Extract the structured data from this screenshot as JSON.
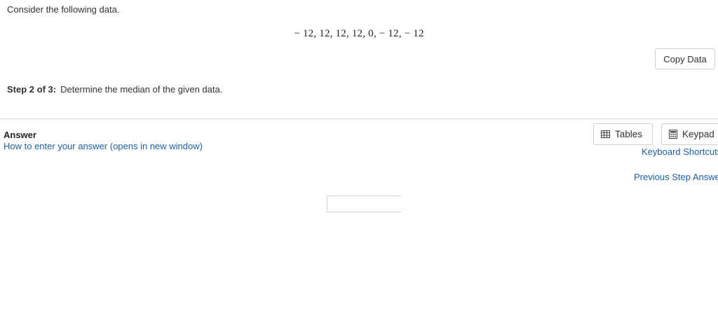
{
  "question": {
    "intro": "Consider the following data.",
    "dataset": "− 12, 12, 12, 12, 0, − 12, − 12",
    "copy_button": "Copy Data"
  },
  "step": {
    "label": "Step 2 of 3",
    "separator": ":",
    "instruction": "Determine the median of the given data."
  },
  "answer": {
    "heading": "Answer",
    "help_link": "How to enter your answer (opens in new window)",
    "input_value": ""
  },
  "tools": {
    "tables_label": "Tables",
    "keypad_label": "Keypad",
    "keyboard_shortcuts": "Keyboard Shortcuts",
    "previous_step": "Previous Step Answers"
  },
  "colors": {
    "link": "#1a5fa8",
    "border": "#cfcfcf",
    "divider": "#d9d9d9"
  }
}
